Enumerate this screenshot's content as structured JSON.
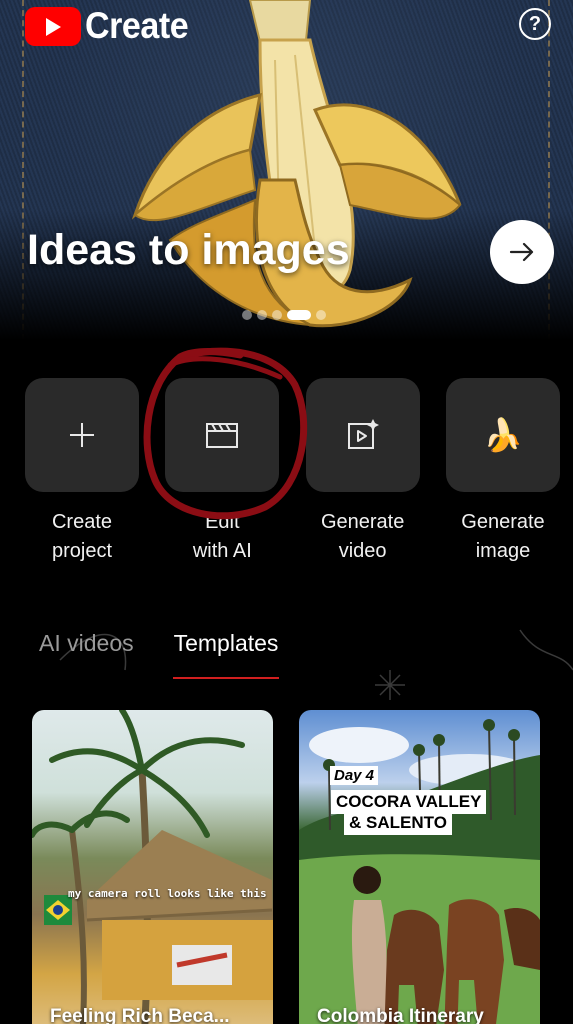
{
  "app": {
    "brand_text": "Create",
    "logo_icon": "youtube-play-icon",
    "accent": "#ff0000"
  },
  "header": {
    "help_icon": "help-circle-icon",
    "help_glyph": "?"
  },
  "hero": {
    "title": "Ideas to images",
    "next_icon": "arrow-right-icon",
    "carousel": {
      "count": 5,
      "active": 3
    }
  },
  "actions": [
    {
      "label_line1": "Create",
      "label_line2": "project",
      "icon": "plus-icon"
    },
    {
      "label_line1": "Edit",
      "label_line2": "with AI",
      "icon": "clapperboard-icon"
    },
    {
      "label_line1": "Generate",
      "label_line2": "video",
      "icon": "video-sparkle-icon"
    },
    {
      "label_line1": "Generate",
      "label_line2": "image",
      "icon": "banana-icon",
      "glyph": "🍌"
    }
  ],
  "tabs": [
    {
      "label": "AI videos",
      "active": false
    },
    {
      "label": "Templates",
      "active": true
    }
  ],
  "tab_indicator_color": "#d11f1f",
  "cards": [
    {
      "caption": "Feeling Rich Beca...",
      "overlay": "my camera roll looks like this"
    },
    {
      "caption": "Colombia Itinerary",
      "day": "Day 4",
      "line1": "COCORA VALLEY",
      "line2": "& SALENTO"
    }
  ]
}
